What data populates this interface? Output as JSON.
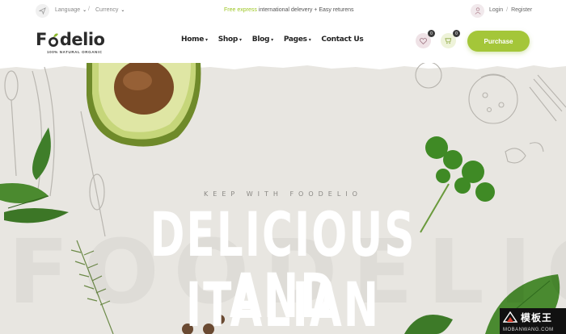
{
  "topbar": {
    "language_label": "Language",
    "currency_label": "Currency",
    "separator": "/",
    "promo_highlight": "Free express",
    "promo_rest": " international delevery + Easy returens",
    "login_label": "Login",
    "register_label": "Register",
    "auth_separator": "/"
  },
  "header": {
    "logo_text_start": "F",
    "logo_text_end": "delio",
    "logo_tagline": "100% NATURAL ORGANIC",
    "nav": [
      {
        "label": "Home",
        "has_dropdown": true
      },
      {
        "label": "Shop",
        "has_dropdown": true
      },
      {
        "label": "Blog",
        "has_dropdown": true
      },
      {
        "label": "Pages",
        "has_dropdown": true
      },
      {
        "label": "Contact Us",
        "has_dropdown": false
      }
    ],
    "wishlist_count": "0",
    "cart_count": "0",
    "purchase_label": "Purchase"
  },
  "hero": {
    "tagline": "KEEP WITH FOODELIO",
    "title_line1": "DELICIOUS AND",
    "title_line2": "ITALIAN",
    "background_word": "FOODELIO"
  },
  "site_watermark": {
    "cn": "模板王",
    "en": "MOBANWANG.COM"
  },
  "colors": {
    "accent": "#a4c639",
    "promo_accent": "#9cc623",
    "hero_bg": "#e8e6e1",
    "text_dark": "#222222"
  },
  "icons": [
    "send-icon",
    "chevron-down-icon",
    "user-icon",
    "heart-icon",
    "cart-icon",
    "leaf-icon"
  ]
}
